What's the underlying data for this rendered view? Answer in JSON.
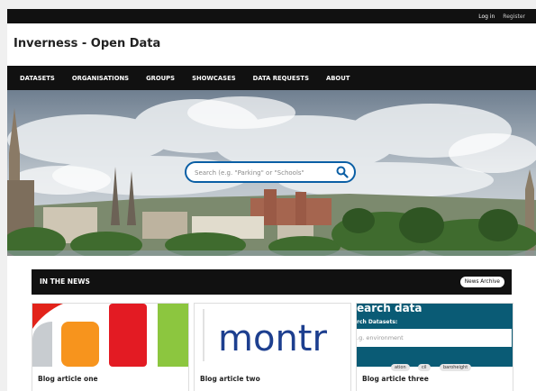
{
  "topbar": {
    "login": "Log in",
    "register": "Register"
  },
  "site": {
    "title": "Inverness - Open Data"
  },
  "nav": [
    "DATASETS",
    "ORGANISATIONS",
    "GROUPS",
    "SHOWCASES",
    "DATA REQUESTS",
    "ABOUT"
  ],
  "search": {
    "placeholder": "Search (e.g. \"Parking\" or \"Schools\""
  },
  "news": {
    "title": "IN THE NEWS",
    "archive_label": "News Archive",
    "articles": [
      {
        "caption": "Blog article one"
      },
      {
        "caption": "Blog article two",
        "image_text": "montr"
      },
      {
        "caption": "Blog article three",
        "image_heading": "earch data",
        "image_label": "rch Datasets:",
        "image_placeholder": ".g. environment",
        "image_tags": [
          "ation",
          "cil",
          "baroheight"
        ]
      }
    ]
  },
  "colors": {
    "dark": "#111111",
    "search_border": "#0b5fa5",
    "teal": "#0a5b75"
  }
}
